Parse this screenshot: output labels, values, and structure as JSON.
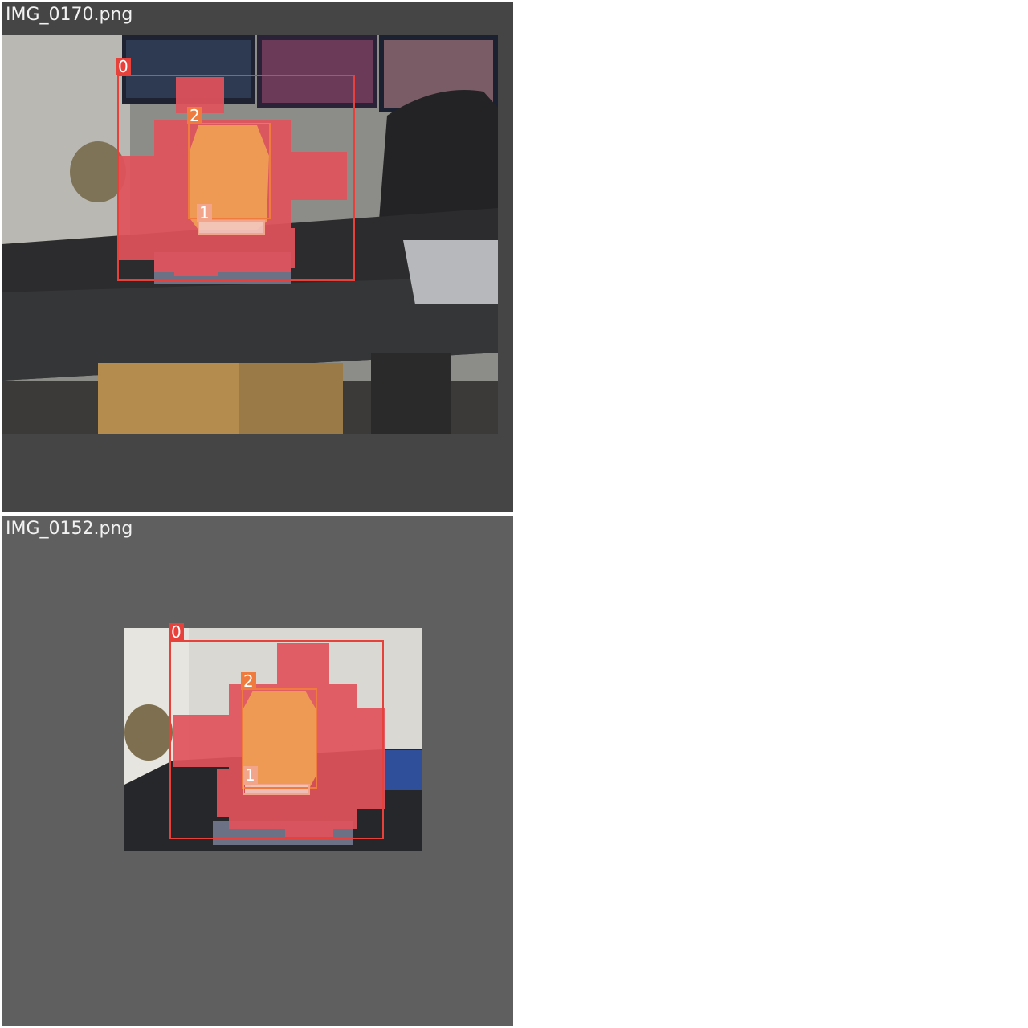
{
  "tiles": [
    {
      "filename": "IMG_0170.png",
      "detections": [
        {
          "class_id": "0",
          "color": "#e8413c"
        },
        {
          "class_id": "1",
          "color": "#f2a58a"
        },
        {
          "class_id": "2",
          "color": "#ef7b3e"
        }
      ]
    },
    {
      "filename": "IMG_0152.png",
      "detections": [
        {
          "class_id": "0",
          "color": "#e8413c"
        },
        {
          "class_id": "1",
          "color": "#f2a58a"
        },
        {
          "class_id": "2",
          "color": "#ef7b3e"
        }
      ]
    }
  ],
  "colors": {
    "tile1_background": "#454545",
    "tile2_background": "#5f5f5f",
    "page_background": "#ffffff",
    "mask_red": "#e2535c",
    "mask_orange": "#ee9a55"
  }
}
